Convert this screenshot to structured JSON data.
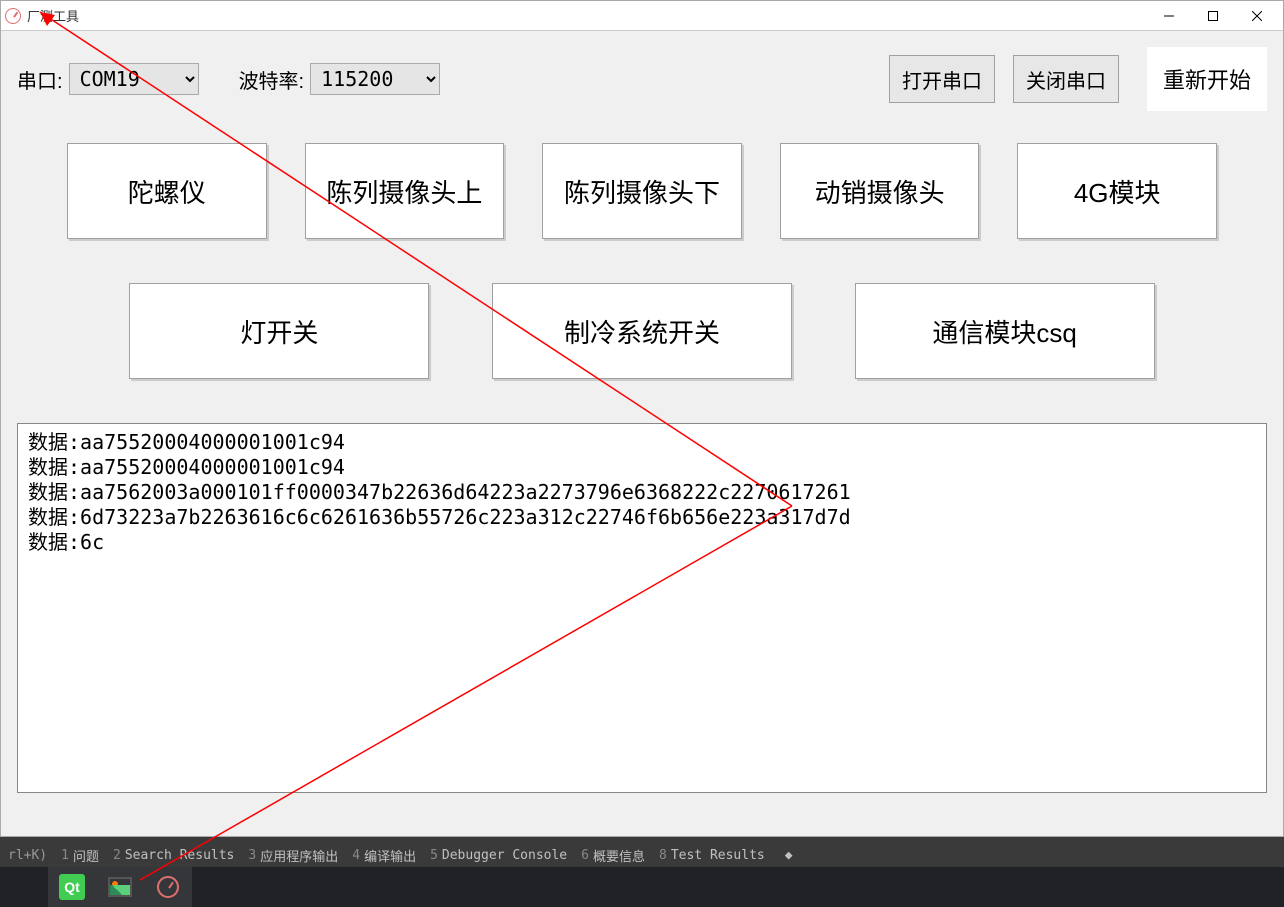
{
  "window": {
    "title": "厂测工具"
  },
  "toolbar": {
    "serial_label": "串口:",
    "serial_value": "COM19",
    "baud_label": "波特率:",
    "baud_value": "115200",
    "open_port": "打开串口",
    "close_port": "关闭串口",
    "restart": "重新开始"
  },
  "buttons_row1": {
    "gyro": "陀螺仪",
    "cam_up": "陈列摄像头上",
    "cam_down": "陈列摄像头下",
    "motion_cam": "动销摄像头",
    "fourg": "4G模块"
  },
  "buttons_row2": {
    "lamp": "灯开关",
    "cooling": "制冷系统开关",
    "csq": "通信模块csq"
  },
  "log_text": "数据:aa75520004000001001c94\n数据:aa75520004000001001c94\n数据:aa7562003a000101ff0000347b22636d64223a2273796e6368222c2270617261\n数据:6d73223a7b2263616c6c6261636b55726c223a312c22746f6b656e223a317d7d\n数据:6c",
  "ide_bar": {
    "hint": "rl+K)",
    "tabs": [
      {
        "n": "1",
        "label": "问题"
      },
      {
        "n": "2",
        "label": "Search Results"
      },
      {
        "n": "3",
        "label": "应用程序输出"
      },
      {
        "n": "4",
        "label": "编译输出"
      },
      {
        "n": "5",
        "label": "Debugger Console"
      },
      {
        "n": "6",
        "label": "概要信息"
      },
      {
        "n": "8",
        "label": "Test Results"
      }
    ]
  }
}
